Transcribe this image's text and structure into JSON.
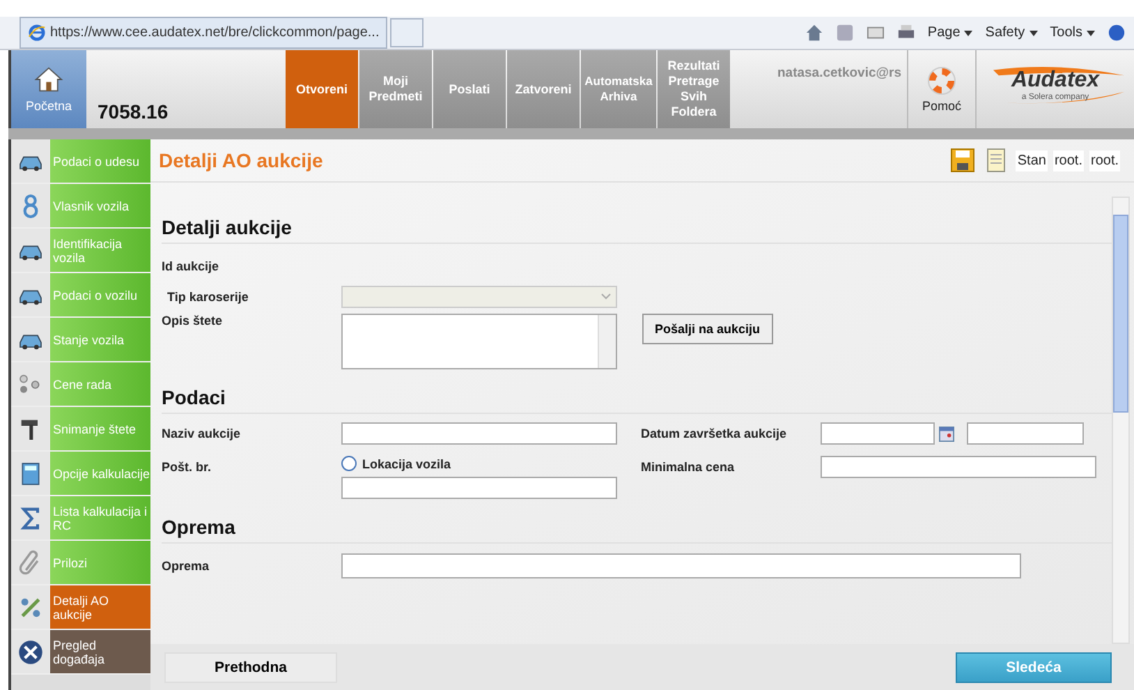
{
  "browser": {
    "tab_title": "https://www.cee.audatex.net/bre/clickcommon/page...",
    "commands": [
      "Page",
      "Safety",
      "Tools"
    ]
  },
  "header": {
    "home_label": "Početna",
    "case_number": "7058.16",
    "tabs": [
      {
        "label": "Otvoreni",
        "selected": true
      },
      {
        "label": "Moji Predmeti",
        "selected": false
      },
      {
        "label": "Poslati",
        "selected": false
      },
      {
        "label": "Zatvoreni",
        "selected": false
      },
      {
        "label": "Automatska Arhiva",
        "selected": false
      },
      {
        "label": "Rezultati Pretrage Svih Foldera",
        "selected": false
      }
    ],
    "user": "natasa.cetkovic@rs",
    "help_label": "Pomoć",
    "logo": "Audatex",
    "logo_tagline": "a Solera company"
  },
  "sidebar": {
    "items": [
      {
        "label": "Podaci o udesu",
        "kind": "step",
        "selected": false
      },
      {
        "label": "Vlasnik vozila",
        "kind": "step",
        "selected": false
      },
      {
        "label": "Identifikacija vozila",
        "kind": "step",
        "selected": false
      },
      {
        "label": "Podaci o vozilu",
        "kind": "step",
        "selected": false
      },
      {
        "label": "Stanje vozila",
        "kind": "step",
        "selected": false
      },
      {
        "label": "Cene rada",
        "kind": "step",
        "selected": false
      },
      {
        "label": "Snimanje štete",
        "kind": "step",
        "selected": false
      },
      {
        "label": "Opcije kalkulacije",
        "kind": "step",
        "selected": false
      },
      {
        "label": "Lista kalkulacija i RC",
        "kind": "step",
        "selected": false
      },
      {
        "label": "Prilozi",
        "kind": "step",
        "selected": false
      },
      {
        "label": "Detalji AO aukcije",
        "kind": "step",
        "selected": true
      },
      {
        "label": "Pregled događaja",
        "kind": "extra",
        "selected": false
      }
    ]
  },
  "page": {
    "title": "Detalji AO aukcije",
    "toolbar_texts": [
      "Stan",
      "root.",
      "root."
    ],
    "section_1": {
      "heading": "Detalji aukcije",
      "id_label": "Id aukcije",
      "body_type_label": "Tip karoserije",
      "damage_label": "Opis štete",
      "send_button": "Pošalji na aukciju"
    },
    "section_2": {
      "heading": "Podaci",
      "name_label": "Naziv aukcije",
      "end_date_label": "Datum završetka aukcije",
      "postal_label": "Pošt. br.",
      "location_radio": {
        "label": "Lokacija vozila",
        "checked": false
      },
      "min_price_label": "Minimalna cena"
    },
    "section_3": {
      "heading": "Oprema",
      "equipment_label": "Oprema"
    },
    "buttons": {
      "previous": "Prethodna",
      "next": "Sledeća"
    }
  }
}
